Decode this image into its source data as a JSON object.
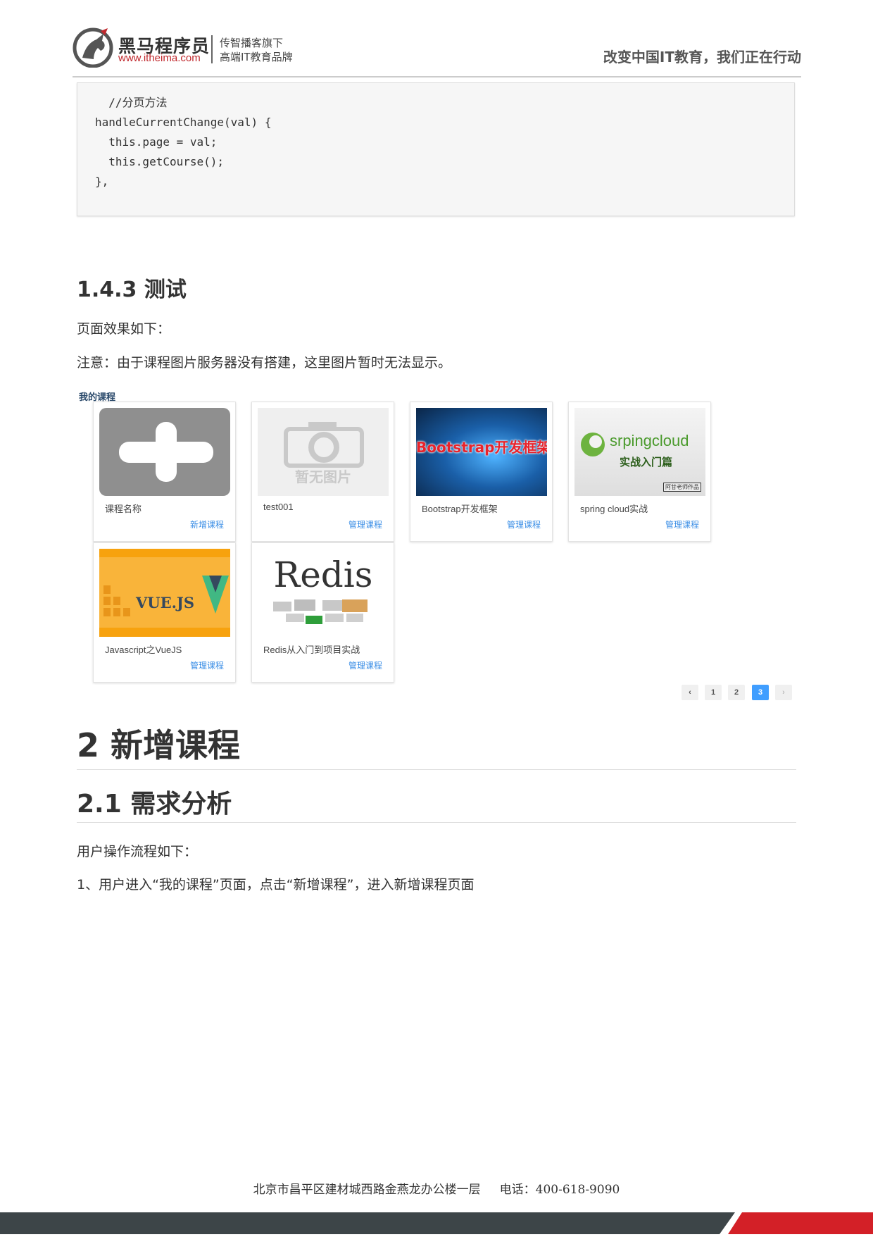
{
  "header": {
    "brand_name": "黑马程序员",
    "brand_url": "www.itheima.com",
    "tagline_line1": "传智播客旗下",
    "tagline_line2": "高端IT教育品牌",
    "slogan": "改变中国IT教育，我们正在行动"
  },
  "code_block": {
    "lines": [
      "  //分页方法",
      "handleCurrentChange(val) {",
      "  this.page = val;",
      "  this.getCourse();",
      "},"
    ]
  },
  "section_143": {
    "title": "1.4.3 测试",
    "effect_text": "页面效果如下：",
    "note_text": "注意：由于课程图片服务器没有搭建，这里图片暂时无法显示。"
  },
  "course_page": {
    "title": "我的课程",
    "cards": [
      {
        "name": "课程名称",
        "link": "新增课程",
        "thumb": "plus-icon"
      },
      {
        "name": "test001",
        "link": "管理课程",
        "thumb": "camera-icon",
        "thumb_text": "暂无图片"
      },
      {
        "name": "Bootstrap开发框架",
        "link": "管理课程",
        "thumb": "bootstrap-banner",
        "thumb_text": "Bootstrap开发框架"
      },
      {
        "name": "spring cloud实战",
        "link": "管理课程",
        "thumb": "springcloud-banner",
        "thumb_text": "srpingcloud",
        "thumb_sub": "实战入门篇",
        "thumb_stamp": "阿甘老师作品"
      },
      {
        "name": "Javascript之VueJS",
        "link": "管理课程",
        "thumb": "vuejs-banner",
        "thumb_text": "VUE.JS"
      },
      {
        "name": "Redis从入门到项目实战",
        "link": "管理课程",
        "thumb": "redis-banner",
        "thumb_text": "Redis"
      }
    ],
    "pagination": {
      "prev": "‹",
      "pages": [
        "1",
        "2",
        "3"
      ],
      "current": "3",
      "next": "›"
    }
  },
  "section_2": {
    "title": "2 新增课程",
    "sub_title": "2.1 需求分析",
    "flow_text": "用户操作流程如下：",
    "step1": "1、用户进入“我的课程”页面，点击“新增课程”，进入新增课程页面"
  },
  "footer": {
    "address": "北京市昌平区建材城西路金燕龙办公楼一层     电话：400-618-9090"
  },
  "colors": {
    "accent_blue": "#409eff",
    "link_blue": "#3a8ee6",
    "brand_red": "#c0282d",
    "footer_dark": "#3d4548",
    "footer_red": "#d32027"
  }
}
